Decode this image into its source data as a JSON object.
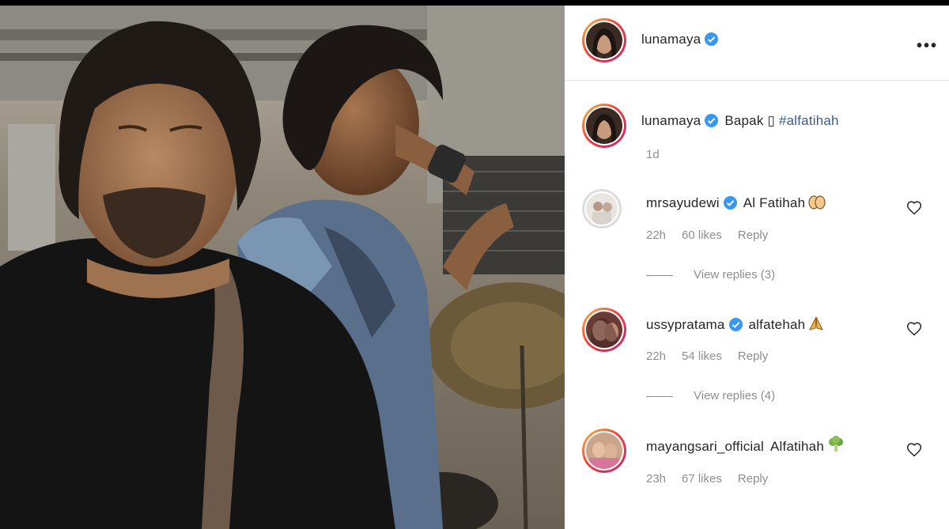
{
  "post": {
    "username": "lunamaya",
    "caption_user": "lunamaya",
    "caption_text": "Bapak",
    "caption_glyph": "▯",
    "caption_hashtag": "#alfatihah",
    "caption_age": "1d",
    "more_label": "•••"
  },
  "comments": [
    {
      "username": "mrsayudewi",
      "text": "Al Fatihah",
      "emoji": "hands-icon",
      "age": "22h",
      "likes": "60 likes",
      "reply": "Reply",
      "view_replies": "View replies (3)",
      "verified": true
    },
    {
      "username": "ussypratama",
      "text": "alfatehah",
      "emoji": "pray-icon",
      "age": "22h",
      "likes": "54 likes",
      "reply": "Reply",
      "view_replies": "View replies (4)",
      "verified": true
    },
    {
      "username": "mayangsari_official",
      "text": "Alfatihah",
      "emoji": "broccoli-icon",
      "age": "23h",
      "likes": "67 likes",
      "reply": "Reply",
      "verified": false
    }
  ],
  "colors": {
    "verified": "#3897f0",
    "story_ring": "#e8463f",
    "text": "#262626",
    "muted": "#8e8e8e"
  }
}
